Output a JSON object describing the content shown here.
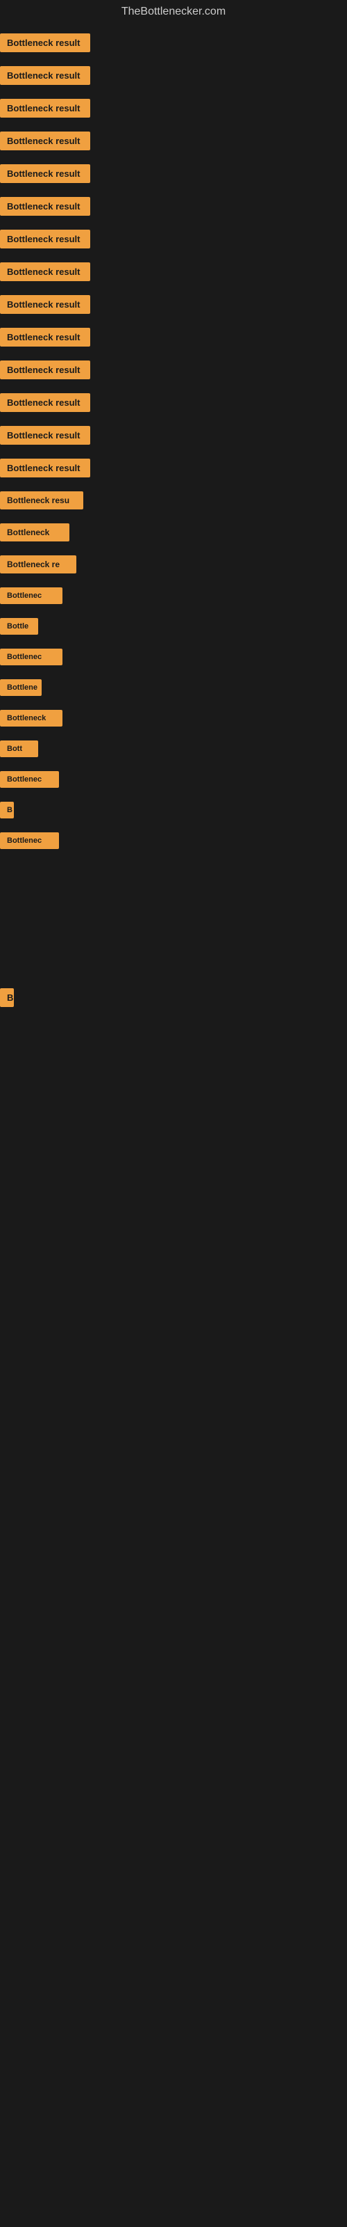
{
  "site": {
    "title": "TheBottlenecker.com"
  },
  "rows": [
    {
      "id": 1,
      "label": "Bottleneck result"
    },
    {
      "id": 2,
      "label": "Bottleneck result"
    },
    {
      "id": 3,
      "label": "Bottleneck result"
    },
    {
      "id": 4,
      "label": "Bottleneck result"
    },
    {
      "id": 5,
      "label": "Bottleneck result"
    },
    {
      "id": 6,
      "label": "Bottleneck result"
    },
    {
      "id": 7,
      "label": "Bottleneck result"
    },
    {
      "id": 8,
      "label": "Bottleneck result"
    },
    {
      "id": 9,
      "label": "Bottleneck result"
    },
    {
      "id": 10,
      "label": "Bottleneck result"
    },
    {
      "id": 11,
      "label": "Bottleneck result"
    },
    {
      "id": 12,
      "label": "Bottleneck result"
    },
    {
      "id": 13,
      "label": "Bottleneck result"
    },
    {
      "id": 14,
      "label": "Bottleneck result"
    },
    {
      "id": 15,
      "label": "Bottleneck resu"
    },
    {
      "id": 16,
      "label": "Bottleneck"
    },
    {
      "id": 17,
      "label": "Bottleneck re"
    },
    {
      "id": 18,
      "label": "Bottlenec"
    },
    {
      "id": 19,
      "label": "Bottle"
    },
    {
      "id": 20,
      "label": "Bottlenec"
    },
    {
      "id": 21,
      "label": "Bottlene"
    },
    {
      "id": 22,
      "label": "Bottleneck"
    },
    {
      "id": 23,
      "label": "Bott"
    },
    {
      "id": 24,
      "label": "Bottlenec"
    },
    {
      "id": 25,
      "label": "B"
    },
    {
      "id": 26,
      "label": "Bottlenec"
    }
  ],
  "bottom_badge": {
    "label": "B"
  }
}
